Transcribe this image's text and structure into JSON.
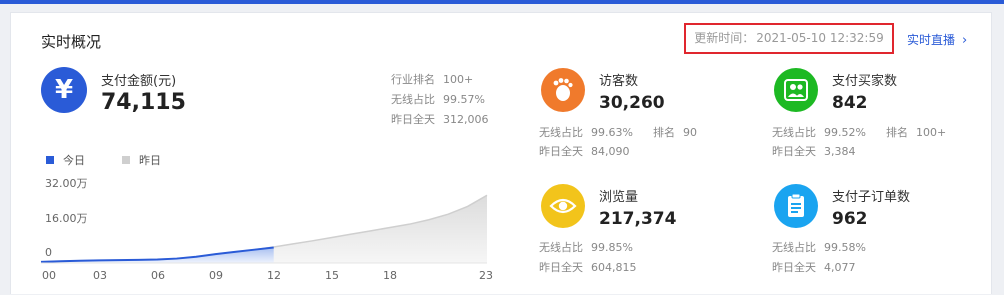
{
  "panel": {
    "title": "实时概况",
    "update_label": "更新时间：",
    "update_time": "2021-05-10 12:32:59",
    "live_link": "实时直播",
    "live_arrow": "›"
  },
  "payment": {
    "icon": "yen-icon",
    "label": "支付金额(元)",
    "value": "74,115",
    "stats": [
      {
        "label": "行业排名",
        "value": "100+"
      },
      {
        "label": "无线占比",
        "value": "99.57%"
      },
      {
        "label": "昨日全天",
        "value": "312,006"
      }
    ]
  },
  "legend": [
    {
      "label": "今日",
      "color": "#2a5bd7"
    },
    {
      "label": "昨日",
      "color": "#cfcfcf"
    }
  ],
  "chart_data": {
    "type": "area",
    "x_tick_labels": [
      "00",
      "03",
      "06",
      "09",
      "12",
      "15",
      "18",
      "23"
    ],
    "y_tick_labels": [
      "32.00万",
      "16.00万",
      "0"
    ],
    "ylim": [
      0,
      32
    ],
    "y_unit": "万",
    "series": [
      {
        "name": "今日",
        "color": "#2a5bd7",
        "x": [
          0,
          1,
          2,
          3,
          4,
          5,
          6,
          7,
          8,
          9,
          10,
          11,
          12
        ],
        "y": [
          0.5,
          0.8,
          1.0,
          1.2,
          1.3,
          1.4,
          1.6,
          2.0,
          2.8,
          4.0,
          5.0,
          6.0,
          7.0
        ]
      },
      {
        "name": "昨日",
        "color": "#cfcfcf",
        "x": [
          0,
          1,
          2,
          3,
          4,
          5,
          6,
          7,
          8,
          9,
          10,
          11,
          12,
          13,
          14,
          15,
          16,
          17,
          18,
          19,
          20,
          21,
          22,
          23
        ],
        "y": [
          0.5,
          0.8,
          1.0,
          1.2,
          1.3,
          1.4,
          1.6,
          2.0,
          2.8,
          4.0,
          5.0,
          6.0,
          7.2,
          8.6,
          10.0,
          11.5,
          13.0,
          14.5,
          16.0,
          17.5,
          19.5,
          22.0,
          25.5,
          30.5
        ]
      }
    ]
  },
  "metrics": [
    {
      "icon": "footprint-icon",
      "color": "#f07a2c",
      "label": "访客数",
      "value": "30,260",
      "rows": [
        [
          {
            "label": "无线占比",
            "value": "99.63%"
          },
          {
            "label": "排名",
            "value": "90"
          }
        ],
        [
          {
            "label": "昨日全天",
            "value": "84,090"
          }
        ]
      ]
    },
    {
      "icon": "users-icon",
      "color": "#1db923",
      "label": "支付买家数",
      "value": "842",
      "rows": [
        [
          {
            "label": "无线占比",
            "value": "99.52%"
          },
          {
            "label": "排名",
            "value": "100+"
          }
        ],
        [
          {
            "label": "昨日全天",
            "value": "3,384"
          }
        ]
      ]
    },
    {
      "icon": "eye-icon",
      "color": "#f2c41b",
      "label": "浏览量",
      "value": "217,374",
      "rows": [
        [
          {
            "label": "无线占比",
            "value": "99.85%"
          }
        ],
        [
          {
            "label": "昨日全天",
            "value": "604,815"
          }
        ]
      ]
    },
    {
      "icon": "clipboard-icon",
      "color": "#1aa4f0",
      "label": "支付子订单数",
      "value": "962",
      "rows": [
        [
          {
            "label": "无线占比",
            "value": "99.58%"
          }
        ],
        [
          {
            "label": "昨日全天",
            "value": "4,077"
          }
        ]
      ]
    }
  ]
}
